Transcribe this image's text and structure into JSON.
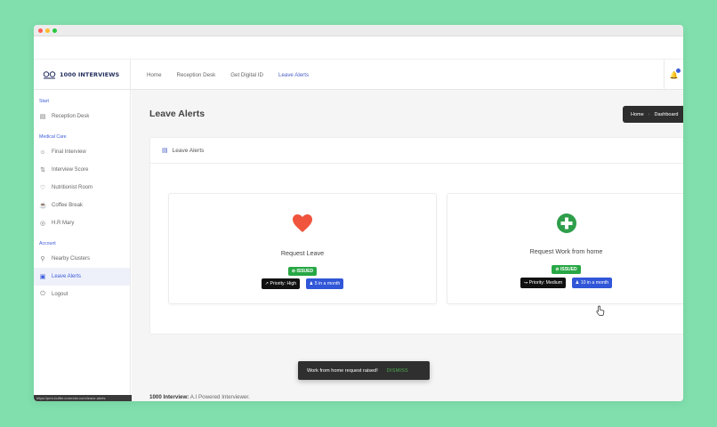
{
  "brand": {
    "name": "1000 INTERVIEWS"
  },
  "topnav": {
    "links": [
      "Home",
      "Reception Desk",
      "Get Digital ID",
      "Leave Alerts"
    ],
    "active_index": 3
  },
  "sidebar": {
    "sections": [
      {
        "title": "Start",
        "items": [
          {
            "label": "Reception Desk",
            "icon": "grid-icon"
          }
        ]
      },
      {
        "title": "Medical Care",
        "items": [
          {
            "label": "Final Interview",
            "icon": "user-icon"
          },
          {
            "label": "Interview Score",
            "icon": "sort-icon"
          },
          {
            "label": "Nutritionist Room",
            "icon": "heart-icon"
          },
          {
            "label": "Coffee Break",
            "icon": "coffee-icon"
          },
          {
            "label": "H.R Mary",
            "icon": "globe-icon"
          }
        ]
      },
      {
        "title": "Account",
        "items": [
          {
            "label": "Nearby Clusters",
            "icon": "map-pin-icon"
          },
          {
            "label": "Leave Alerts",
            "icon": "alert-icon"
          },
          {
            "label": "Logout",
            "icon": "power-icon"
          }
        ]
      }
    ],
    "status_tip": "https://pmr-buffer.onrender.com/leave-alerts"
  },
  "main": {
    "title": "Leave Alerts",
    "breadcrumb": {
      "home": "Home",
      "current": "Dashboard"
    },
    "panel_title": "Leave Alerts",
    "cards": [
      {
        "title": "Request Leave",
        "status": "ISSUED",
        "priority": "Priority: High",
        "quota": "5 in a month",
        "icon": "heart-icon",
        "icon_color": "#f0543c"
      },
      {
        "title": "Request Work from home",
        "status": "ISSUED",
        "priority": "Priority: Medium",
        "quota": "10 in a month",
        "icon": "plus-circle-icon",
        "icon_color": "#2e9e4a"
      }
    ]
  },
  "footer": {
    "brand": "1000 Interview:",
    "tagline": "A.I Powered Interviewer."
  },
  "toast": {
    "message": "Work from home request raised!",
    "action": "DISMISS"
  },
  "colors": {
    "background": "#80dfad",
    "accent": "#3b5bdb",
    "success": "#28a745"
  }
}
